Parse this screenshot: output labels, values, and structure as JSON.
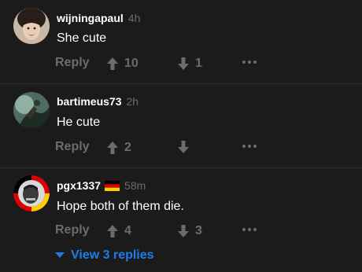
{
  "comments": [
    {
      "username": "wijningapaul",
      "time": "4h",
      "text": "She cute",
      "reply_label": "Reply",
      "upvotes": "10",
      "downvotes": "1"
    },
    {
      "username": "bartimeus73",
      "time": "2h",
      "text": "He cute",
      "reply_label": "Reply",
      "upvotes": "2",
      "downvotes": ""
    },
    {
      "username": "pgx1337",
      "time": "58m",
      "text": "Hope both of them die.",
      "reply_label": "Reply",
      "upvotes": "4",
      "downvotes": "3",
      "flag": "Germany"
    }
  ],
  "view_replies_label": "View 3 replies",
  "colors": {
    "background": "#1b1b1b",
    "muted": "#6c6c6c",
    "link": "#1e7ce8"
  },
  "icons": [
    "upvote-arrow-icon",
    "downvote-arrow-icon",
    "more-options-icon",
    "expand-chevron-icon"
  ]
}
